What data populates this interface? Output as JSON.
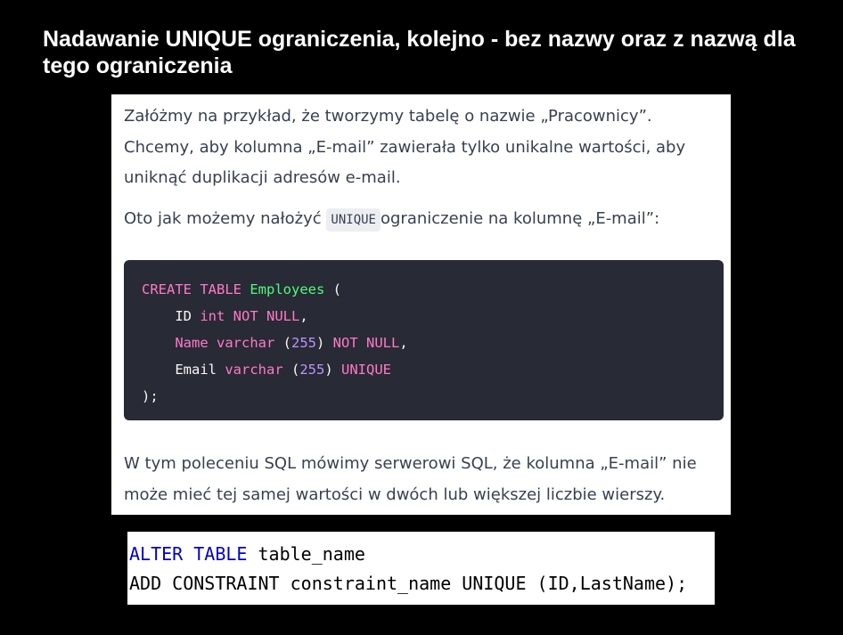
{
  "heading": "Nadawanie UNIQUE ograniczenia, kolejno - bez nazwy oraz z nazwą dla tego ograniczenia",
  "article": {
    "paragraph1": "Załóżmy na przykład, że tworzymy tabelę o nazwie „Pracownicy”. Chcemy, aby kolumna „E-mail” zawierała tylko unikalne wartości, aby uniknąć duplikacji adresów e-mail.",
    "paragraph2_before": "Oto jak możemy nałożyć ",
    "paragraph2_code": "UNIQUE",
    "paragraph2_after": "ograniczenie na kolumnę „E-mail”:",
    "paragraph3": "W tym poleceniu SQL mówimy serwerowi SQL, że kolumna „E-mail” nie może mieć tej samej wartości w dwóch lub większej liczbie wierszy."
  },
  "code1": {
    "l1_kw": "CREATE TABLE ",
    "l1_name": "Employees",
    "l1_end": " (",
    "l2_indent": "    ",
    "l2_col": "ID ",
    "l2_type": "int NOT NULL",
    "l2_end": ",",
    "l3_indent": "    ",
    "l3_kw": "Name varchar",
    "l3_open": " (",
    "l3_num": "255",
    "l3_close": ") ",
    "l3_tail": "NOT NULL",
    "l3_end": ",",
    "l4_indent": "    ",
    "l4_col": "Email ",
    "l4_type": "varchar",
    "l4_open": " (",
    "l4_num": "255",
    "l4_close": ") ",
    "l4_tail": "UNIQUE",
    "l5": ");"
  },
  "code2": {
    "l1_kw": "ALTER TABLE",
    "l1_rest": " table_name",
    "l2": "ADD CONSTRAINT constraint_name UNIQUE (ID,LastName);"
  },
  "colors": {
    "code_bg": "#282a36",
    "keyword_pink": "#ff79c6",
    "identifier_green": "#50fa7b",
    "number_purple": "#bd93f9",
    "sql_keyword_blue": "#0000cd"
  }
}
